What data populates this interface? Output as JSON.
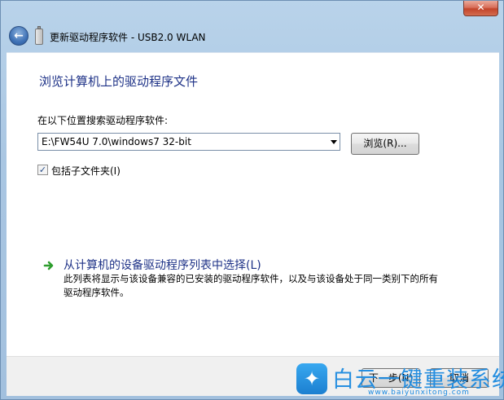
{
  "window": {
    "close_label": "✕",
    "title": "更新驱动程序软件 - USB2.0 WLAN"
  },
  "main": {
    "heading": "浏览计算机上的驱动程序文件",
    "search_label": "在以下位置搜索驱动程序软件:",
    "path_value": "E:\\FW54U 7.0\\windows7 32-bit",
    "browse_label": "浏览(R)...",
    "include_subfolders": {
      "label": "包括子文件夹(I)",
      "checked": true
    },
    "pick_option": {
      "title": "从计算机的设备驱动程序列表中选择(L)",
      "description": "此列表将显示与该设备兼容的已安装的驱动程序软件，以及与该设备处于同一类别下的所有驱动程序软件。"
    }
  },
  "footer": {
    "next_label": "下一步(N)",
    "cancel_label": "取消"
  },
  "watermark": {
    "text": "白云一键重装系统",
    "url": "www.baiyunxitong.com"
  },
  "icons": [
    "back-arrow-icon",
    "usb-device-icon",
    "green-arrow-icon",
    "dropdown-arrow-icon",
    "checkmark-icon"
  ]
}
